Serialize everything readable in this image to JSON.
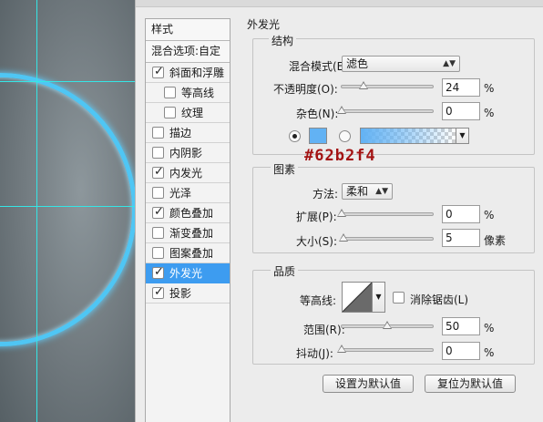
{
  "canvas": {},
  "style_list": {
    "header": "样式",
    "blend": "混合选项:自定",
    "items": [
      {
        "label": "斜面和浮雕",
        "checked": true,
        "sub": false
      },
      {
        "label": "等高线",
        "checked": false,
        "sub": true
      },
      {
        "label": "纹理",
        "checked": false,
        "sub": true
      },
      {
        "label": "描边",
        "checked": false,
        "sub": false
      },
      {
        "label": "内阴影",
        "checked": false,
        "sub": false
      },
      {
        "label": "内发光",
        "checked": true,
        "sub": false
      },
      {
        "label": "光泽",
        "checked": false,
        "sub": false
      },
      {
        "label": "颜色叠加",
        "checked": true,
        "sub": false
      },
      {
        "label": "渐变叠加",
        "checked": false,
        "sub": false
      },
      {
        "label": "图案叠加",
        "checked": false,
        "sub": false
      },
      {
        "label": "外发光",
        "checked": true,
        "sub": false,
        "active": true
      },
      {
        "label": "投影",
        "checked": true,
        "sub": false
      }
    ],
    "check_glyph": "✓"
  },
  "panel": {
    "title": "外发光",
    "structure": {
      "label": "结构",
      "blend_mode_label": "混合模式(E):",
      "blend_mode_value": "滤色",
      "opacity_label": "不透明度(O):",
      "opacity_value": "24",
      "opacity_fraction": 0.24,
      "noise_label": "杂色(N):",
      "noise_value": "0",
      "noise_fraction": 0,
      "percent": "%",
      "color_hex_label": "#62b2f4",
      "color": "#62b2f4"
    },
    "elements": {
      "label": "图素",
      "technique_label": "方法:",
      "technique_value": "柔和",
      "spread_label": "扩展(P):",
      "spread_value": "0",
      "spread_fraction": 0,
      "size_label": "大小(S):",
      "size_value": "5",
      "size_fraction": 0.02,
      "percent": "%",
      "pixel_unit": "像素"
    },
    "quality": {
      "label": "品质",
      "contour_label": "等高线:",
      "antialias_label": "消除锯齿(L)",
      "range_label": "范围(R):",
      "range_value": "50",
      "range_fraction": 0.5,
      "jitter_label": "抖动(J):",
      "jitter_value": "0",
      "jitter_fraction": 0,
      "percent": "%"
    },
    "buttons": {
      "set_default": "设置为默认值",
      "reset_default": "复位为默认值"
    }
  },
  "colors": {
    "accent": "#3d9cf0",
    "glow": "#62b2f4",
    "hex_annotation": "#a31313"
  }
}
